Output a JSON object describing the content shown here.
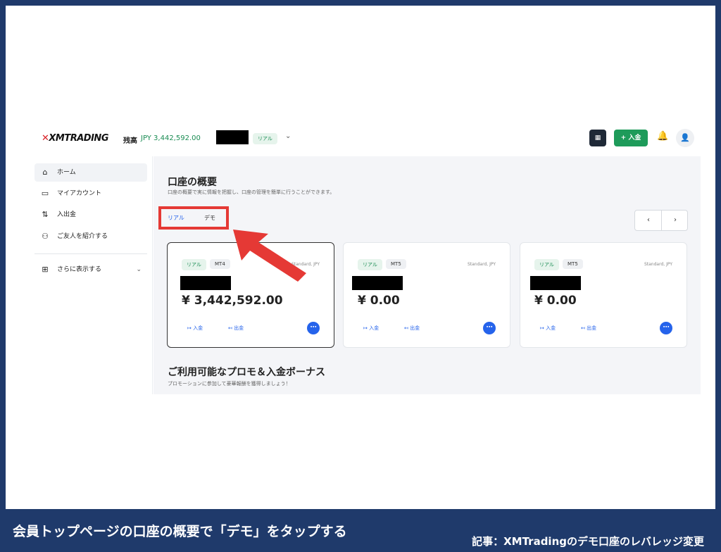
{
  "topnav": {
    "logo": "XMTRADING",
    "balance_label": "残高",
    "balance_value": "JPY 3,442,592.00",
    "account_pill": "リアル",
    "deposit_button": "+ 入金"
  },
  "sidebar": {
    "items": [
      {
        "label": "ホーム",
        "icon": "home-icon"
      },
      {
        "label": "マイアカウント",
        "icon": "card-icon"
      },
      {
        "label": "入出金",
        "icon": "transfer-icon"
      },
      {
        "label": "ご友人を紹介する",
        "icon": "people-icon"
      }
    ],
    "more_label": "さらに表示する"
  },
  "main": {
    "title": "口座の概要",
    "subtitle": "口座の概要で実に情報を把握し、口座の管理を簡単に行うことができます。",
    "tabs": [
      "リアル",
      "デモ"
    ],
    "cards": [
      {
        "pill": "リアル",
        "platform": "MT4",
        "type": "Standard, JPY",
        "amount": "¥ 3,442,592.00",
        "deposit": "入金",
        "withdraw": "出金"
      },
      {
        "pill": "リアル",
        "platform": "MT5",
        "type": "Standard, JPY",
        "amount": "¥ 0.00",
        "deposit": "入金",
        "withdraw": "出金"
      },
      {
        "pill": "リアル",
        "platform": "MT5",
        "type": "Standard, JPY",
        "amount": "¥ 0.00",
        "deposit": "入金",
        "withdraw": "出金"
      }
    ],
    "promo_title": "ご利用可能なプロモ＆入金ボーナス",
    "promo_subtitle": "プロモーションに参加して豪華報酬を獲得しましょう！"
  },
  "caption": "会員トップページの口座の概要で「デモ」をタップする",
  "article": "記事：XMTradingのデモ口座のレバレッジ変更",
  "colors": {
    "accent": "#2563eb",
    "green": "#1e9b5a",
    "highlight": "#e53935",
    "banner": "#1f3a6b"
  }
}
